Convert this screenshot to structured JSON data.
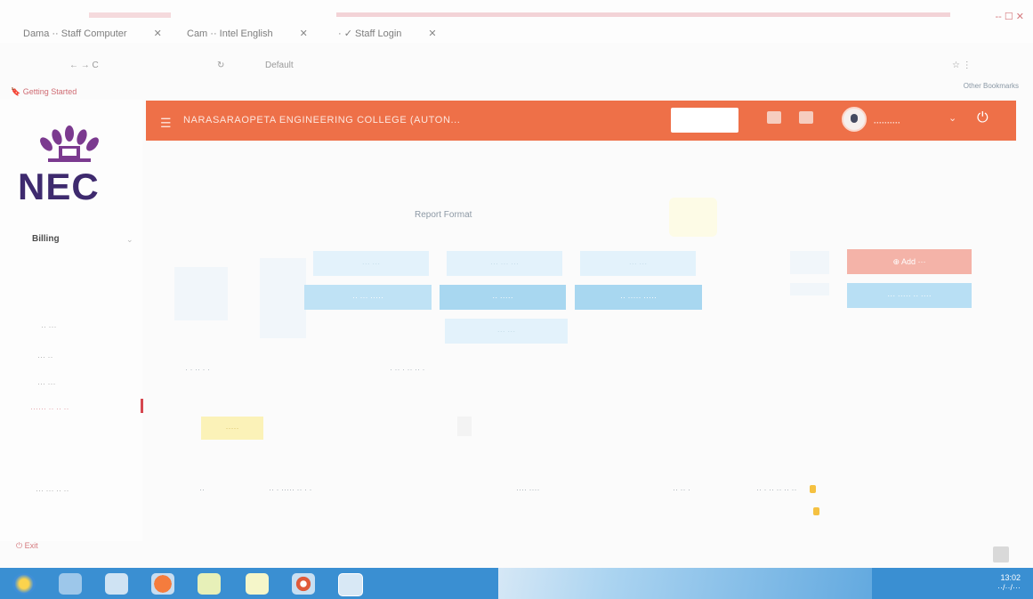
{
  "browser": {
    "tabs": [
      {
        "label": "Dama ·· Staff Computer"
      },
      {
        "label": "Cam ·· Intel English"
      },
      {
        "label": "· ✓ Staff Login"
      }
    ],
    "window_controls": "-- ☐ ✕",
    "address_left": "← → C",
    "address_url": "Default",
    "address_right": "☆ ⋮",
    "bookmark": "🔖 Getting Started",
    "bookmark_right": "Other Bookmarks"
  },
  "sidebar": {
    "logo_text": "NEC",
    "active_item": "Billing",
    "items": [
      "·· ···",
      "··· ··",
      "··· ···",
      "······ ·· ·· ··",
      "··· ··· ·· ··"
    ],
    "logout": "⏻ Exit"
  },
  "header": {
    "title": "NARASARAOPETA ENGINEERING COLLEGE (AUTON...",
    "menu_icon": "hamburger-icon",
    "user_line1": "·····",
    "user_name": "··········",
    "power_icon": "power-icon"
  },
  "content": {
    "report_title": "Report Format",
    "buttons_row1": [
      "··· ···",
      "··· ··· ···",
      "··· ···"
    ],
    "buttons_row2": [
      "·· ··· ·····",
      "·· ·····",
      "·· ····· ·····"
    ],
    "buttons_row3": [
      "··· ···"
    ],
    "right_buttons": [
      "⊕ Add ···",
      "··· ····· ·· ····"
    ],
    "filter_label_left": "· · ·· · ·",
    "filter_label_mid": "· ·· · ·· ·· ·",
    "yellow_button": "·····",
    "row": {
      "col1": "··",
      "col2": "·· · ····· ·· · ·",
      "col3": "···· ····",
      "col4": "·· ·· ·",
      "col5": "·· · ·· ·· ·· ··"
    }
  },
  "taskbar": {
    "time": "13:02",
    "date": "··/··/···"
  },
  "colors": {
    "header_orange": "#ee7048",
    "logo_purple": "#3e2a6e",
    "taskbar_blue": "#3a8fd2"
  }
}
